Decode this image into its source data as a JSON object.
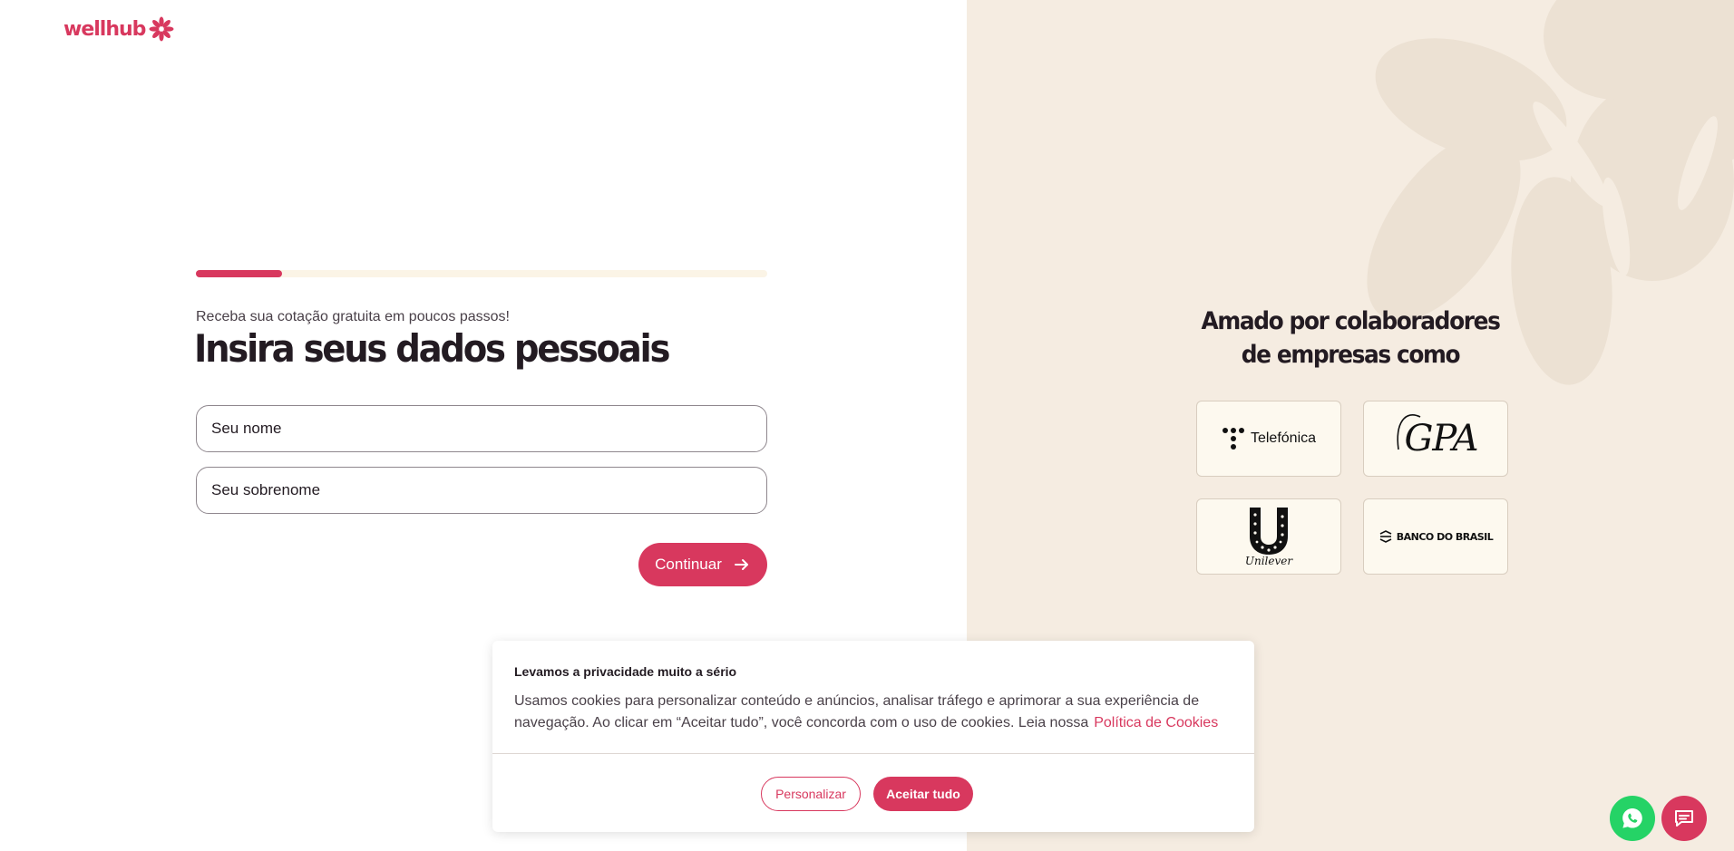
{
  "brand": {
    "name": "wellhub",
    "accent": "#d8385e"
  },
  "progress": {
    "fraction": 0.15
  },
  "form": {
    "subtitle": "Receba sua cotação gratuita em poucos passos!",
    "title": "Insira seus dados pessoais",
    "first_name_placeholder": "Seu nome",
    "last_name_placeholder": "Seu sobrenome",
    "continue_label": "Continuar"
  },
  "companies": {
    "title": "Amado por colaboradores de empresas como",
    "logos": [
      {
        "name": "Telefónica"
      },
      {
        "name": "GPA"
      },
      {
        "name": "Unilever"
      },
      {
        "name": "BANCO DO BRASIL"
      }
    ]
  },
  "cookie_banner": {
    "title": "Levamos a privacidade muito a sério",
    "text": "Usamos cookies para personalizar conteúdo e anúncios, analisar tráfego e aprimorar a sua experiência de navegação. Ao clicar em “Aceitar tudo”, você concorda com o uso de cookies. Leia nossa",
    "link_label": "Política de Cookies",
    "personalize_label": "Personalizar",
    "accept_label": "Aceitar tudo"
  },
  "floating": {
    "whatsapp_icon": "whatsapp-icon",
    "chat_icon": "chat-icon",
    "whatsapp_color": "#25d366"
  }
}
